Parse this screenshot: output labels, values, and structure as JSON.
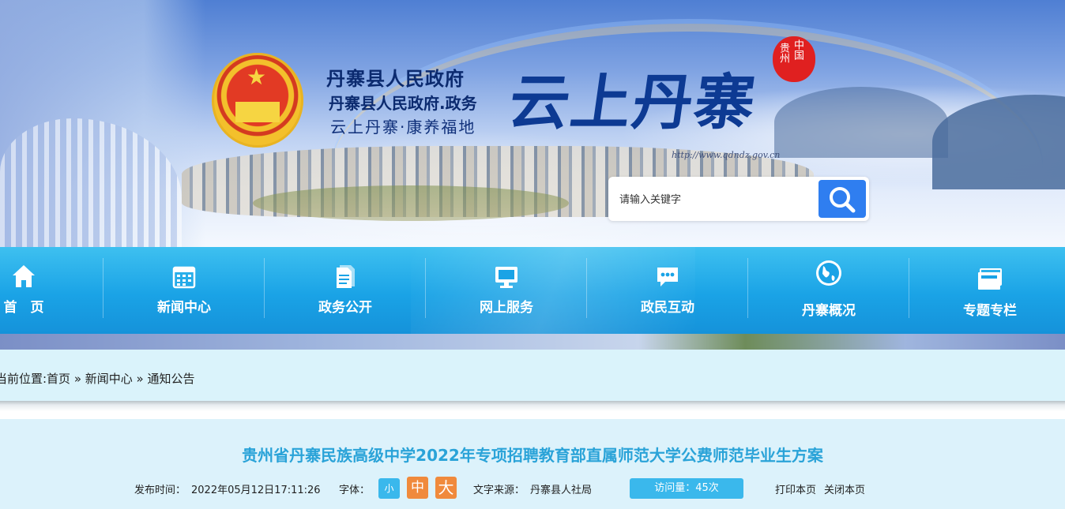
{
  "header": {
    "site_name": "丹寨县人民政府",
    "site_subtitle": "丹寨县人民政府.政务",
    "slogan": "云上丹寨·康养福地",
    "big_title": "云上丹寨",
    "seal_left": "贵州",
    "seal_right": "中国",
    "url_text": "http://www.qdndz.gov.cn"
  },
  "search": {
    "placeholder": "请输入关键字"
  },
  "nav": {
    "items": [
      {
        "label": "首　页",
        "icon": "home-icon"
      },
      {
        "label": "新闻中心",
        "icon": "calendar-icon"
      },
      {
        "label": "政务公开",
        "icon": "document-icon"
      },
      {
        "label": "网上服务",
        "icon": "monitor-icon"
      },
      {
        "label": "政民互动",
        "icon": "chat-icon"
      },
      {
        "label": "丹寨概况",
        "icon": "globe-icon"
      },
      {
        "label": "专题专栏",
        "icon": "folder-icon"
      }
    ]
  },
  "breadcrumb": {
    "text": "当前位置:首页 » 新闻中心 » 通知公告"
  },
  "article": {
    "title": "贵州省丹寨民族高级中学2022年专项招聘教育部直属师范大学公费师范毕业生方案",
    "publish_label": "发布时间：",
    "publish_time": "2022年05月12日17:11:26",
    "font_label": "字体：",
    "font_small": "小",
    "font_medium": "中",
    "font_large": "大",
    "source_label": "文字来源：",
    "source": "丹寨县人社局",
    "views": "访问量：45次",
    "print": "打印本页",
    "close": "关闭本页"
  },
  "colors": {
    "nav_blue": "#1aa3e6",
    "title_blue": "#2aa3d8",
    "font_small_bg": "#3ab8ec",
    "font_mid_bg": "#f08a3c",
    "search_button": "#2f7ef0"
  }
}
